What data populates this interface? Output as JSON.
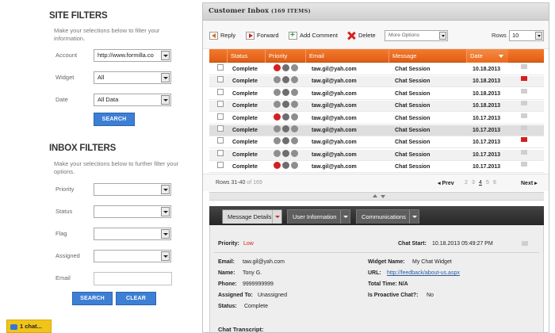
{
  "site_filters": {
    "title": "SITE FILTERS",
    "description": "Make your selections below to filter your information.",
    "account_label": "Account",
    "account_value": "http://www.formilla.co",
    "widget_label": "Widget",
    "widget_value": "All",
    "date_label": "Date",
    "date_value": "All Data",
    "search_label": "SEARCH"
  },
  "inbox_filters": {
    "title": "INBOX FILTERS",
    "description": "Make your selections below to further filter your options.",
    "priority_label": "Priority",
    "status_label": "Status",
    "flag_label": "Flag",
    "assigned_label": "Assigned",
    "email_label": "Email",
    "search_label": "SEARCH",
    "clear_label": "CLEAR"
  },
  "chat_tab": {
    "label": "1 chat..."
  },
  "inbox": {
    "title": "Customer Inbox",
    "count": "(169 ITEMS)",
    "toolbar": {
      "reply": "Reply",
      "forward": "Forward",
      "add_comment": "Add Comment",
      "delete": "Delete",
      "more_options": "More Options",
      "rows_label": "Rows",
      "rows_value": "10"
    },
    "columns": [
      "Status",
      "Priority",
      "Email",
      "Message",
      "Date"
    ],
    "rows": [
      {
        "status": "Complete",
        "email": "taw.gil@yah.com",
        "message": "Chat Session",
        "date": "10.18.2013",
        "priority_color": "#d42020",
        "flag": "gray"
      },
      {
        "status": "Complete",
        "email": "taw.gil@yah.com",
        "message": "Chat Session",
        "date": "10.18.2013",
        "priority_color": "#8e8e8e",
        "flag": "red"
      },
      {
        "status": "Complete",
        "email": "taw.gil@yah.com",
        "message": "Chat Session",
        "date": "10.18.2013",
        "priority_color": "#8e8e8e",
        "flag": "gray"
      },
      {
        "status": "Complete",
        "email": "taw.gil@yah.com",
        "message": "Chat Session",
        "date": "10.18.2013",
        "priority_color": "#8e8e8e",
        "flag": "gray"
      },
      {
        "status": "Complete",
        "email": "taw.gil@yah.com",
        "message": "Chat Session",
        "date": "10.17.2013",
        "priority_color": "#d42020",
        "flag": "gray"
      },
      {
        "status": "Complete",
        "email": "taw.gil@yah.com",
        "message": "Chat Session",
        "date": "10.17.2013",
        "priority_color": "#8e8e8e",
        "flag": "gray"
      },
      {
        "status": "Complete",
        "email": "taw.gil@yah.com",
        "message": "Chat Session",
        "date": "10.17.2013",
        "priority_color": "#8e8e8e",
        "flag": "red"
      },
      {
        "status": "Complete",
        "email": "taw.gil@yah.com",
        "message": "Chat Session",
        "date": "10.17.2013",
        "priority_color": "#8e8e8e",
        "flag": "gray"
      },
      {
        "status": "Complete",
        "email": "taw.gil@yah.com",
        "message": "Chat Session",
        "date": "10.17.2013",
        "priority_color": "#d42020",
        "flag": "gray"
      }
    ],
    "pager": {
      "range": "Rows 31-40",
      "total": "of 169",
      "prev": "◂ Prev",
      "pages": [
        "2",
        "3",
        "4",
        "5",
        "6"
      ],
      "next": "Next ▸"
    },
    "detail_tabs": [
      "Message Details",
      "User Information",
      "Communications"
    ],
    "details": {
      "priority_label": "Priority:",
      "priority_value": "Low",
      "chat_start_label": "Chat Start:",
      "chat_start_value": "10.18.2013 05:49:27 PM",
      "email_label": "Email:",
      "email_value": "taw.gil@yah.com",
      "name_label": "Name:",
      "name_value": "Tony G.",
      "phone_label": "Phone:",
      "phone_value": "9999999999",
      "assigned_label": "Assigned To:",
      "assigned_value": "Unassigned",
      "status_label": "Status:",
      "status_value": "Complete",
      "widget_name_label": "Widget Name:",
      "widget_name_value": "My Chat Widget",
      "url_label": "URL:",
      "url_value": "http://feedback/about-us.aspx",
      "total_time_label": "Total Time: N/A",
      "proactive_label": "Is Proactive Chat?:",
      "proactive_value": "No",
      "transcript_label": "Chat Transcript:"
    }
  }
}
